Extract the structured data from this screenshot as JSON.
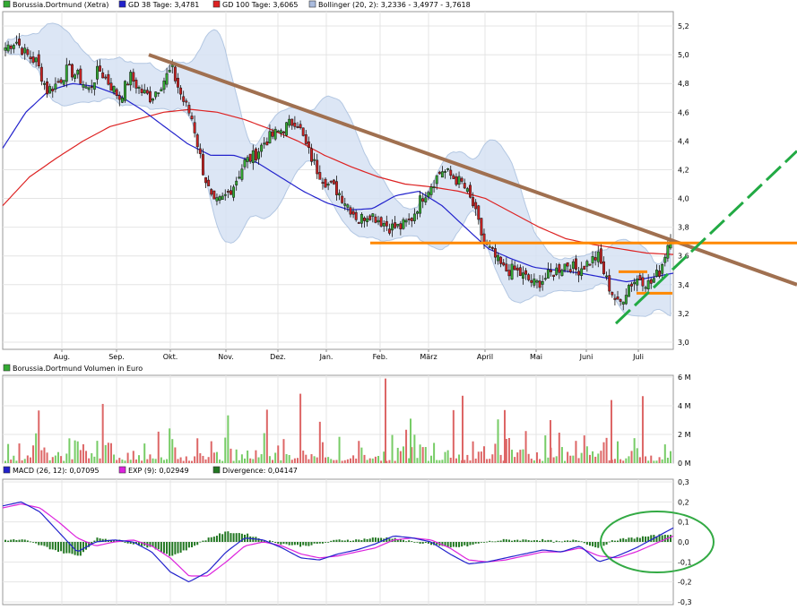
{
  "chart_data": [
    {
      "type": "candlestick",
      "legend": [
        {
          "label": "Borussia.Dortmund (Xetra)",
          "color": "#33aa33"
        },
        {
          "label": "GD 38 Tage: 3,4781",
          "color": "#2222cc"
        },
        {
          "label": "GD 100 Tage: 3,6065",
          "color": "#dd2222"
        },
        {
          "label": "Bollinger (20, 2): 3,2336 - 3,4977 - 3,7618",
          "color": "#aabbdd"
        }
      ],
      "y_ticks": [
        "5,2",
        "5,0",
        "4,8",
        "4,6",
        "4,4",
        "4,2",
        "4,0",
        "3,8",
        "3,6",
        "3,4",
        "3,2",
        "3,0"
      ],
      "ylim": [
        2.95,
        5.3
      ],
      "x_ticks": [
        "Aug.",
        "Sep.",
        "Okt.",
        "Nov.",
        "Dez.",
        "Jan.",
        "Feb.",
        "März",
        "April",
        "Mai",
        "Juni",
        "Juli"
      ],
      "grid": true,
      "price_series": [
        5.05,
        5.1,
        5.0,
        4.95,
        4.75,
        4.8,
        4.9,
        4.85,
        4.75,
        4.9,
        4.8,
        4.7,
        4.85,
        4.75,
        4.7,
        4.8,
        4.9,
        4.7,
        4.55,
        4.2,
        3.95,
        4.0,
        4.1,
        4.25,
        4.3,
        4.4,
        4.45,
        4.5,
        4.55,
        4.35,
        4.2,
        4.1,
        4.05,
        3.95,
        3.85,
        3.9,
        3.85,
        3.8,
        3.8,
        3.85,
        4.0,
        4.1,
        4.2,
        4.15,
        4.1,
        3.95,
        3.7,
        3.6,
        3.5,
        3.5,
        3.45,
        3.4,
        3.45,
        3.5,
        3.55,
        3.5,
        3.55,
        3.6,
        3.4,
        3.25,
        3.4,
        3.45,
        3.4,
        3.5,
        3.75
      ],
      "gd38": [
        4.35,
        4.6,
        4.75,
        4.8,
        4.78,
        4.72,
        4.62,
        4.5,
        4.38,
        4.3,
        4.3,
        4.25,
        4.15,
        4.05,
        3.97,
        3.92,
        3.93,
        4.02,
        4.05,
        3.95,
        3.8,
        3.65,
        3.58,
        3.52,
        3.5,
        3.48,
        3.45,
        3.42,
        3.45,
        3.48
      ],
      "gd100": [
        3.95,
        4.15,
        4.28,
        4.4,
        4.5,
        4.55,
        4.6,
        4.62,
        4.6,
        4.55,
        4.48,
        4.4,
        4.3,
        4.22,
        4.15,
        4.1,
        4.08,
        4.05,
        4.0,
        3.9,
        3.8,
        3.72,
        3.68,
        3.65,
        3.62,
        3.61
      ],
      "annotations": [
        {
          "kind": "trendline",
          "color": "#a07050",
          "from": [
            "Sep.",
            5.0
          ],
          "to": [
            "end",
            3.4
          ]
        },
        {
          "kind": "support",
          "color": "#ff8800",
          "level": 3.69
        },
        {
          "kind": "trendline",
          "color": "#22aa44",
          "style": "dashed",
          "from": [
            "Juni",
            3.13
          ],
          "to": [
            "end",
            4.33
          ]
        }
      ]
    },
    {
      "type": "bar",
      "legend": [
        {
          "label": "Borussia.Dortmund Volumen in Euro",
          "color": "#33aa33"
        }
      ],
      "y_ticks": [
        "6 M",
        "4 M",
        "2 M",
        "0 M"
      ],
      "ylim": [
        0,
        6000000
      ]
    },
    {
      "type": "line",
      "legend": [
        {
          "label": "MACD (26, 12): 0,07095",
          "color": "#2222cc"
        },
        {
          "label": "EXP (9): 0,02949",
          "color": "#dd22dd"
        },
        {
          "label": "Divergence: 0,04147",
          "color": "#227722"
        }
      ],
      "y_ticks": [
        "0,3",
        "0,2",
        "0,1",
        "0,0",
        "-0,1",
        "-0,2",
        "-0,3"
      ],
      "ylim": [
        -0.3,
        0.3
      ],
      "macd": [
        0.18,
        0.2,
        0.15,
        0.05,
        -0.05,
        0.0,
        0.01,
        0.0,
        -0.05,
        -0.15,
        -0.2,
        -0.15,
        -0.05,
        0.02,
        0.01,
        -0.03,
        -0.08,
        -0.09,
        -0.06,
        -0.04,
        -0.01,
        0.03,
        0.02,
        0.0,
        -0.06,
        -0.11,
        -0.1,
        -0.08,
        -0.06,
        -0.04,
        -0.05,
        -0.02,
        -0.1,
        -0.07,
        -0.03,
        0.02,
        0.07
      ],
      "signal": [
        0.17,
        0.19,
        0.17,
        0.1,
        0.02,
        -0.02,
        0.0,
        0.01,
        -0.02,
        -0.08,
        -0.17,
        -0.17,
        -0.1,
        -0.02,
        0.0,
        -0.02,
        -0.06,
        -0.08,
        -0.07,
        -0.05,
        -0.03,
        0.01,
        0.02,
        0.01,
        -0.03,
        -0.09,
        -0.1,
        -0.09,
        -0.07,
        -0.05,
        -0.05,
        -0.03,
        -0.07,
        -0.08,
        -0.05,
        -0.01,
        0.03
      ],
      "highlight": "ellipse"
    }
  ]
}
